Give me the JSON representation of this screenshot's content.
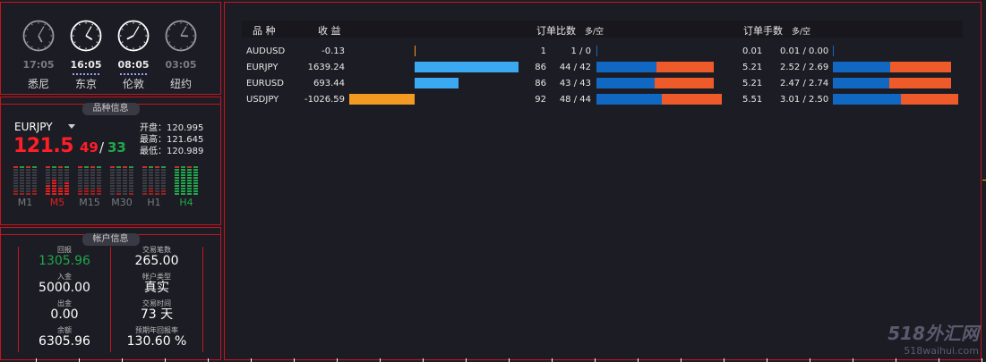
{
  "clocks": [
    {
      "time": "17:05",
      "city": "悉尼",
      "active": false,
      "h": 5,
      "m": 5
    },
    {
      "time": "16:05",
      "city": "东京",
      "active": true,
      "h": 4,
      "m": 5
    },
    {
      "time": "08:05",
      "city": "伦敦",
      "active": true,
      "h": 8,
      "m": 5
    },
    {
      "time": "03:05",
      "city": "纽约",
      "active": false,
      "h": 3,
      "m": 5
    }
  ],
  "product": {
    "title": "品种信息",
    "symbol": "EURJPY",
    "price_main": "121.5",
    "bid_tail": "49",
    "separator": "/",
    "ask_tail": "33",
    "open": "开盘：120.995",
    "high": "最高：121.645",
    "low": "最低：120.989",
    "timeframes": [
      {
        "label": "M1",
        "color": "#7a7a80"
      },
      {
        "label": "M5",
        "color": "#e02020"
      },
      {
        "label": "M15",
        "color": "#7a7a80"
      },
      {
        "label": "M30",
        "color": "#7a7a80"
      },
      {
        "label": "H1",
        "color": "#7a7a80"
      },
      {
        "label": "H4",
        "color": "#1fa84a"
      }
    ]
  },
  "account": {
    "title": "帐户信息",
    "left": [
      {
        "label": "回报",
        "value": "1305.96",
        "color": "#1fa84a"
      },
      {
        "label": "入金",
        "value": "5000.00",
        "color": "#ffffff"
      },
      {
        "label": "出金",
        "value": "0.00",
        "color": "#ffffff"
      },
      {
        "label": "余额",
        "value": "6305.96",
        "color": "#ffffff"
      }
    ],
    "right": [
      {
        "label": "交易笔数",
        "value": "265.00",
        "color": "#ffffff"
      },
      {
        "label": "帐户类型",
        "value": "真实",
        "color": "#ffffff"
      },
      {
        "label": "交易时间",
        "value": "73 天",
        "color": "#ffffff"
      },
      {
        "label": "预期年回报率",
        "value": "130.60 %",
        "color": "#ffffff"
      }
    ]
  },
  "table": {
    "headers": {
      "symbol": "品 种",
      "profit": "收 益",
      "order_ratio": "订单比数",
      "order_ratio_unit": "多/空",
      "lot_ratio": "订单手数",
      "lot_ratio_unit": "多/空"
    },
    "rows": [
      {
        "symbol": "AUDUSD",
        "profit": "-0.13",
        "profit_value": -0.13,
        "orders": "1",
        "orders_split": "1 / 0",
        "long_orders": 1,
        "short_orders": 0,
        "lots": "0.01",
        "lots_split": "0.01 / 0.00",
        "long_lots": 0.01,
        "short_lots": 0.0
      },
      {
        "symbol": "EURJPY",
        "profit": "1639.24",
        "profit_value": 1639.24,
        "orders": "86",
        "orders_split": "44 / 42",
        "long_orders": 44,
        "short_orders": 42,
        "lots": "5.21",
        "lots_split": "2.52 / 2.69",
        "long_lots": 2.52,
        "short_lots": 2.69
      },
      {
        "symbol": "EURUSD",
        "profit": "693.44",
        "profit_value": 693.44,
        "orders": "86",
        "orders_split": "43 / 43",
        "long_orders": 43,
        "short_orders": 43,
        "lots": "5.21",
        "lots_split": "2.47 / 2.74",
        "long_lots": 2.47,
        "short_lots": 2.74
      },
      {
        "symbol": "USDJPY",
        "profit": "-1026.59",
        "profit_value": -1026.59,
        "orders": "92",
        "orders_split": "48 / 44",
        "long_orders": 48,
        "short_orders": 44,
        "lots": "5.51",
        "lots_split": "3.01 / 2.50",
        "long_lots": 3.01,
        "short_lots": 2.5
      }
    ]
  },
  "watermark": {
    "line1": "518外汇网",
    "line2": "518waihui.com"
  },
  "colors": {
    "accent_red": "#c8141e",
    "long_blue": "#1168c2",
    "short_orange": "#ee5a2a",
    "profit_blue": "#3aa9f2",
    "loss_amber": "#f39a22"
  }
}
